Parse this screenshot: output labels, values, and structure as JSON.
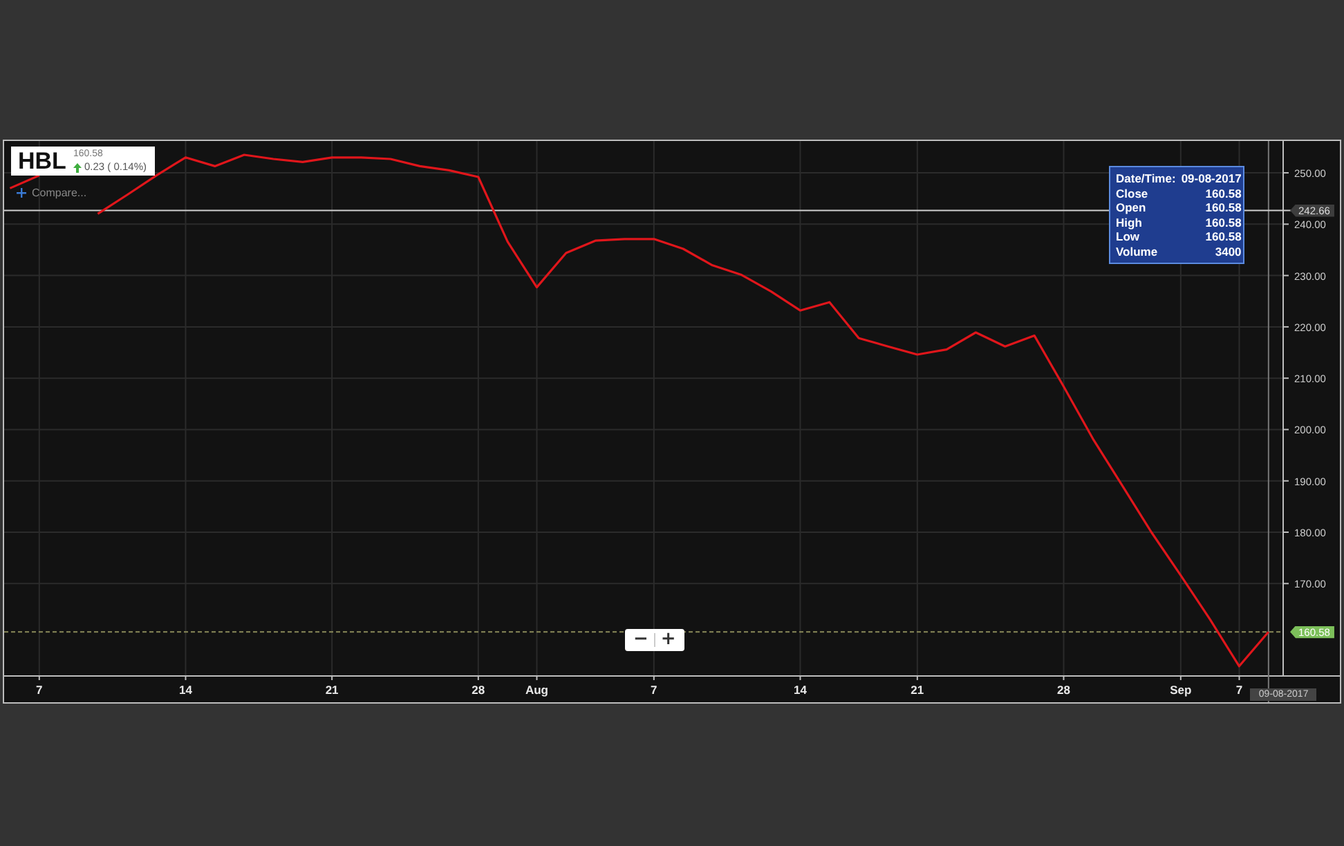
{
  "instrument": {
    "price": "160.58",
    "change": "0.23 ( 0.14%)",
    "up": true
  },
  "compare": {
    "label": "Compare..."
  },
  "tooltip": {
    "rows": [
      {
        "label": "Date/Time:",
        "value": "09-08-2017"
      },
      {
        "label": "Close",
        "value": "160.58"
      },
      {
        "label": "Open",
        "value": "160.58"
      },
      {
        "label": "High",
        "value": "160.58"
      },
      {
        "label": "Low",
        "value": "160.58"
      },
      {
        "label": "Volume",
        "value": "3400"
      }
    ]
  },
  "crosshair": {
    "price": "242.66",
    "date": "09-08-2017"
  },
  "last_price": {
    "label": "160.58"
  },
  "zoom": [
    "−",
    "+"
  ],
  "chart_data": {
    "type": "line",
    "categories": [
      null,
      "7",
      null,
      null,
      null,
      null,
      "14",
      null,
      null,
      null,
      null,
      "21",
      null,
      null,
      null,
      null,
      "28",
      null,
      "Aug",
      null,
      null,
      null,
      "7",
      null,
      null,
      null,
      null,
      "14",
      null,
      null,
      null,
      "21",
      null,
      null,
      null,
      null,
      "28",
      null,
      null,
      null,
      "Sep",
      null,
      "7",
      null
    ],
    "series": [
      {
        "name": "HBL",
        "color": "#e0161b",
        "values": [
          247,
          249.5,
          null,
          242,
          245.7,
          249.5,
          253,
          251.3,
          253.5,
          252.7,
          252.1,
          253,
          253,
          252.7,
          251.3,
          250.5,
          249.2,
          236.6,
          227.7,
          234.4,
          236.8,
          237.1,
          237.1,
          235.2,
          232,
          230.1,
          226.9,
          223.2,
          224.8,
          217.8,
          216.2,
          214.6,
          215.6,
          218.9,
          216.2,
          218.3,
          208.4,
          198.2,
          189.1,
          180,
          171.6,
          163,
          153.9,
          160.6
        ]
      }
    ],
    "ylim": [
      152,
      256.2
    ],
    "grid": true,
    "ref_lines": [
      {
        "axis": "y",
        "value": 242.66,
        "color": "#cfcfcf"
      },
      {
        "axis": "y",
        "value": 160.58,
        "color": "#8a8a5a"
      }
    ],
    "yticks": [
      {
        "value": 170,
        "label": "170.00"
      },
      {
        "value": 180,
        "label": "180.00"
      },
      {
        "value": 190,
        "label": "190.00"
      },
      {
        "value": 200,
        "label": "200.00"
      },
      {
        "value": 210,
        "label": "210.00"
      },
      {
        "value": 220,
        "label": "220.00"
      },
      {
        "value": 230,
        "label": "230.00"
      },
      {
        "value": 240,
        "label": "240.00"
      },
      {
        "value": 250,
        "label": "250.00"
      }
    ]
  }
}
